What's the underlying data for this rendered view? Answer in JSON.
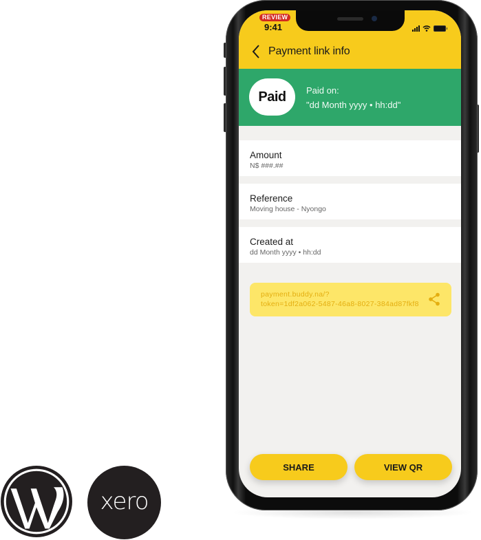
{
  "logos": {
    "wordpress": "wordpress-logo",
    "xero": {
      "text": "xero"
    }
  },
  "status_bar": {
    "review_badge": "REVIEW",
    "time": "9:41",
    "icons": [
      "signal-icon",
      "wifi-icon",
      "battery-icon"
    ]
  },
  "header": {
    "back_icon": "chevron-left-icon",
    "title": "Payment link info"
  },
  "status_banner": {
    "badge": "Paid",
    "paid_on_label": "Paid on:",
    "paid_on_value": "\"dd Month yyyy  •  hh:dd\"",
    "color": "#2ea76a"
  },
  "details": [
    {
      "label": "Amount",
      "value": "N$ ###.##"
    },
    {
      "label": "Reference",
      "value": "Moving house - Nyongo"
    },
    {
      "label": "Created at",
      "value": "dd Month yyyy  •  hh:dd"
    }
  ],
  "payment_link": {
    "line1": "payment.buddy.na/?",
    "line2": "token=1df2a062-5487-46a8-8027-384ad87fkf8",
    "icon": "share-icon"
  },
  "actions": {
    "share_label": "SHARE",
    "view_qr_label": "VIEW QR"
  },
  "colors": {
    "brand_yellow": "#f7cb1c",
    "success_green": "#2ea76a",
    "link_bg": "#fde668",
    "link_text": "#e4ae10"
  }
}
